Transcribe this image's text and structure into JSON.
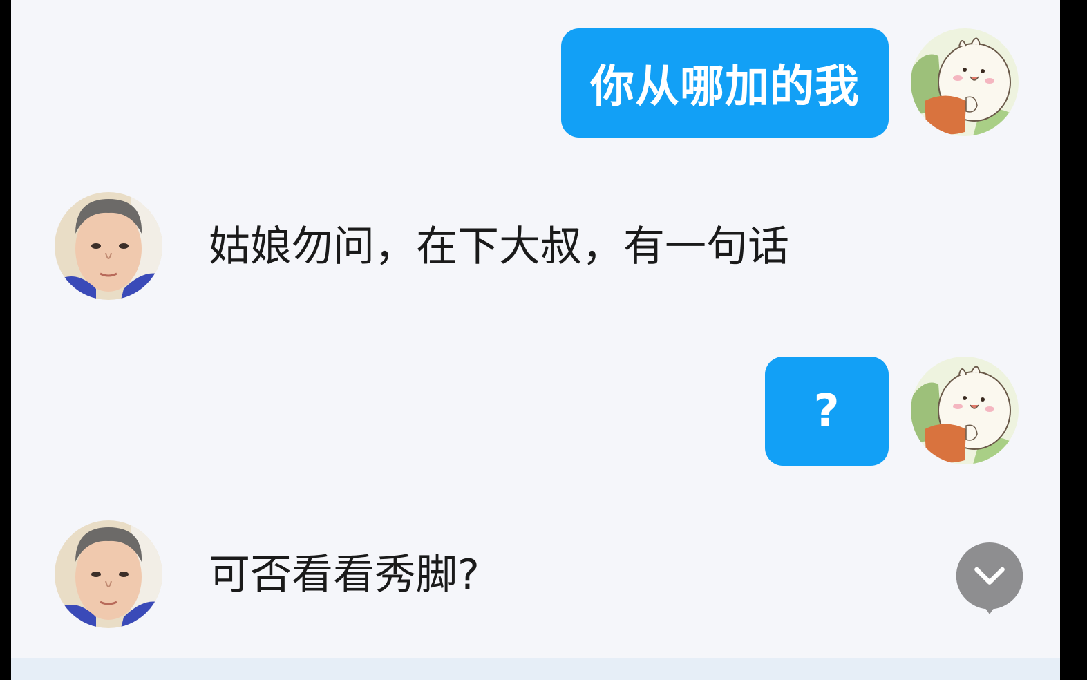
{
  "chat": {
    "messages": [
      {
        "direction": "outgoing",
        "text": "你从哪加的我",
        "avatar": "cartoon-sticker-avatar"
      },
      {
        "direction": "incoming",
        "text": "姑娘勿问，在下大叔，有一句话",
        "avatar": "man-photo-avatar"
      },
      {
        "direction": "outgoing",
        "text": "?",
        "avatar": "cartoon-sticker-avatar"
      },
      {
        "direction": "incoming",
        "text": "可否看看秀脚?",
        "avatar": "man-photo-avatar"
      }
    ],
    "scroll_down_icon": "chevron-down-icon"
  },
  "colors": {
    "outgoing_bubble": "#12a0f6",
    "background": "#f5f6fa",
    "scroll_button": "#8e8e90"
  }
}
